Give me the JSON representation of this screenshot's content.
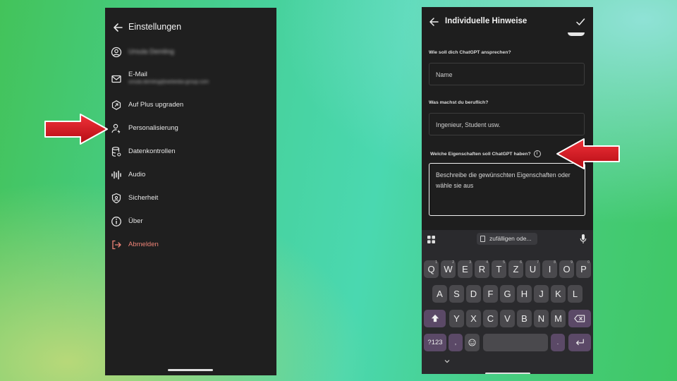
{
  "settings": {
    "title": "Einstellungen",
    "items": [
      {
        "label": "Ursula Demling",
        "icon": "account-icon",
        "blurred": true
      },
      {
        "label": "E-Mail",
        "sublabel": "ursula.demling@webedia-group.com",
        "icon": "mail-icon"
      },
      {
        "label": "Auf Plus upgraden",
        "icon": "plus-upgrade-icon"
      },
      {
        "label": "Personalisierung",
        "icon": "personalization-icon"
      },
      {
        "label": "Datenkontrollen",
        "icon": "data-controls-icon"
      },
      {
        "label": "Audio",
        "icon": "audio-icon"
      },
      {
        "label": "Sicherheit",
        "icon": "security-icon"
      },
      {
        "label": "Über",
        "icon": "info-icon"
      },
      {
        "label": "Abmelden",
        "icon": "logout-icon",
        "color": "#ee8377"
      }
    ]
  },
  "custom": {
    "title": "Individuelle Hinweise",
    "q1_label": "Wie soll dich ChatGPT ansprechen?",
    "q1_placeholder": "Name",
    "q2_label": "Was machst du beruflich?",
    "q2_placeholder": "Ingenieur, Student usw.",
    "q3_label": "Welche Eigenschaften soll ChatGPT haben?",
    "q3_placeholder": "Beschreibe die gewünschten Eigenschaften oder wähle sie aus"
  },
  "keyboard": {
    "suggestion": "zufälligen ode...",
    "row1": [
      {
        "k": "Q",
        "alt": "1"
      },
      {
        "k": "W",
        "alt": "2"
      },
      {
        "k": "E",
        "alt": "3"
      },
      {
        "k": "R",
        "alt": "4"
      },
      {
        "k": "T",
        "alt": "5"
      },
      {
        "k": "Z",
        "alt": "6"
      },
      {
        "k": "U",
        "alt": "7"
      },
      {
        "k": "I",
        "alt": "8"
      },
      {
        "k": "O",
        "alt": "9"
      },
      {
        "k": "P",
        "alt": "0"
      }
    ],
    "row2": [
      "A",
      "S",
      "D",
      "F",
      "G",
      "H",
      "J",
      "K",
      "L"
    ],
    "row3": [
      "Y",
      "X",
      "C",
      "V",
      "B",
      "N",
      "M"
    ],
    "symbols_key": "?123",
    "comma_key": ",",
    "period_key": "."
  },
  "colors": {
    "arrow_red": "#d7161d",
    "logout_text": "#ee8377",
    "special_key": "#5b4967",
    "key": "#4a494d"
  }
}
